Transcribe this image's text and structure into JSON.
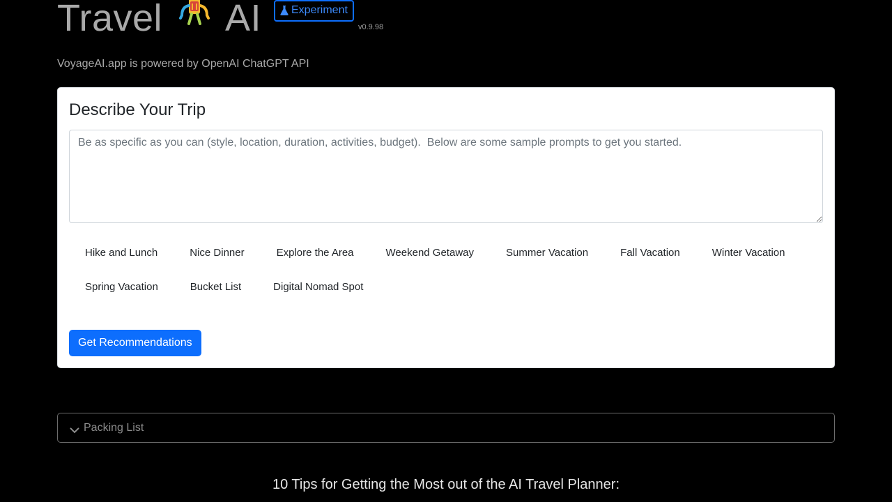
{
  "header": {
    "title_left": "Travel",
    "title_right": "AI",
    "mascot_icon": "backpack-robot-mascot-icon",
    "experiment_badge": {
      "label": "Experiment",
      "icon": "flask-icon"
    },
    "version": "v0.9.98",
    "powered_by": "VoyageAI.app is powered by OpenAI ChatGPT API"
  },
  "trip_card": {
    "title": "Describe Your Trip",
    "input": {
      "value": "",
      "placeholder": "Be as specific as you can (style, location, duration, activities, budget).  Below are some sample prompts to get you started."
    },
    "sample_prompts": [
      "Hike and Lunch",
      "Nice Dinner",
      "Explore the Area",
      "Weekend Getaway",
      "Summer Vacation",
      "Fall Vacation",
      "Winter Vacation",
      "Spring Vacation",
      "Bucket List",
      "Digital Nomad Spot"
    ],
    "submit_label": "Get Recommendations"
  },
  "packing_list": {
    "label": "Packing List",
    "icon": "chevron-down-icon",
    "expanded": false
  },
  "tips": {
    "title": "10 Tips for Getting the Most out of the AI Travel Planner:"
  },
  "colors": {
    "accent": "#0d6efd",
    "background": "#000000",
    "card": "#ffffff",
    "muted_text": "#a9a9a9"
  }
}
